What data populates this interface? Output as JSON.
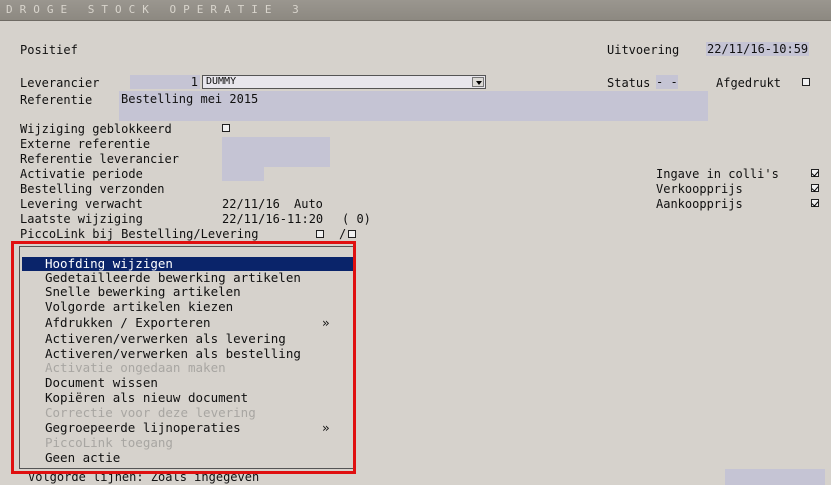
{
  "window": {
    "title": "DROGE STOCK OPERATIE 3"
  },
  "header": {
    "mode": "Positief",
    "execution_label": "Uitvoering",
    "execution_value": "22/11/16-10:59"
  },
  "supplier": {
    "label": "Leverancier",
    "number": "1",
    "name": "DUMMY"
  },
  "status": {
    "label": "Status",
    "value": "- -",
    "printed_label": "Afgedrukt",
    "printed_checked": false
  },
  "reference": {
    "label": "Referentie",
    "value": "Bestelling mei 2015"
  },
  "fields": {
    "change_blocked": "Wijziging geblokkeerd",
    "external_ref": "Externe referentie",
    "supplier_ref": "Referentie leverancier",
    "activation_period": "Activatie periode",
    "order_sent": "Bestelling verzonden",
    "delivery_expected": "Levering verwacht",
    "delivery_expected_value": "22/11/16",
    "delivery_expected_mode": "Auto",
    "last_change": "Laatste wijziging",
    "last_change_value": "22/11/16-11:20",
    "last_change_count": "( 0)",
    "piccolink": "PiccoLink bij Bestelling/Levering",
    "piccolink_sep": "/"
  },
  "options": {
    "colli": {
      "label": "Ingave in colli's",
      "checked": true
    },
    "sale_price": {
      "label": "Verkoopprijs",
      "checked": true
    },
    "purchase_price": {
      "label": "Aankoopprijs",
      "checked": true
    }
  },
  "menu": {
    "items": [
      {
        "label": "Hoofding wijzigen",
        "state": "selected"
      },
      {
        "label": "Gedetailleerde bewerking artikelen",
        "state": "enabled"
      },
      {
        "label": "Snelle bewerking artikelen",
        "state": "enabled"
      },
      {
        "label": "Volgorde artikelen kiezen",
        "state": "enabled"
      },
      {
        "label": "Afdrukken / Exporteren",
        "state": "enabled",
        "submenu": "»"
      },
      {
        "label": "Activeren/verwerken als levering",
        "state": "enabled"
      },
      {
        "label": "Activeren/verwerken als bestelling",
        "state": "enabled"
      },
      {
        "label": "Activatie ongedaan maken",
        "state": "disabled"
      },
      {
        "label": "Document wissen",
        "state": "enabled"
      },
      {
        "label": "Kopiëren als nieuw document",
        "state": "enabled"
      },
      {
        "label": "Correctie voor deze levering",
        "state": "disabled"
      },
      {
        "label": "Gegroepeerde lijnoperaties",
        "state": "enabled",
        "submenu": "»"
      },
      {
        "label": "PiccoLink toegang",
        "state": "disabled"
      },
      {
        "label": "Geen actie",
        "state": "enabled"
      }
    ]
  },
  "footer": {
    "line_order": "Volgorde lijnen: Zoals ingegeven"
  },
  "colors": {
    "field_bg": "#c5c4d4",
    "selection": "#0a246a",
    "highlight_border": "#e01010",
    "background": "#d6d2cc"
  }
}
